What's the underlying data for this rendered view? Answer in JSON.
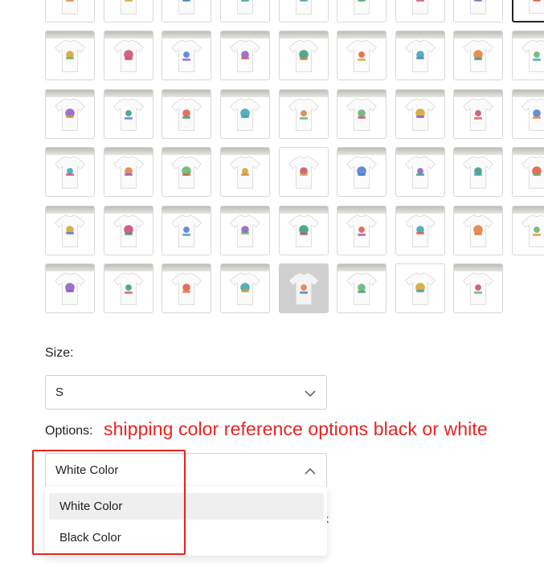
{
  "size": {
    "label": "Size:",
    "selected": "S"
  },
  "options": {
    "label": "Options:",
    "annotation": "shipping color reference options black or white",
    "selected": "White Color",
    "dropdown_items": [
      {
        "label": "White Color",
        "active": true
      },
      {
        "label": "Black Color",
        "active": false
      }
    ],
    "partial_hidden_text": "ck"
  },
  "thumbnails": {
    "rows": 6,
    "columns": 9,
    "last_row_count": 8,
    "selected_index": 8,
    "annotation_color": "#e8231f"
  },
  "icons": {
    "size_select_chevron": "chevron-down-icon",
    "options_select_chevron": "chevron-up-icon"
  }
}
